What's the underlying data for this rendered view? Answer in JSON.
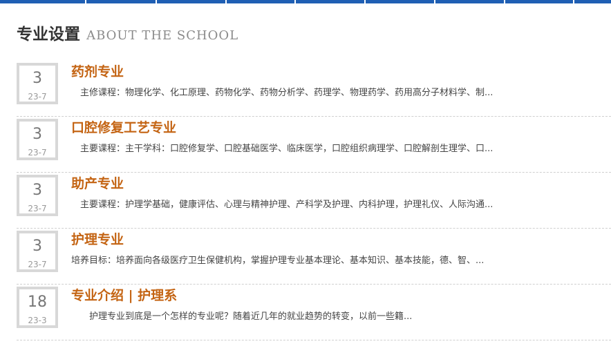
{
  "header": {
    "title_cn": "专业设置",
    "title_en": "ABOUT THE SCHOOL"
  },
  "colors": {
    "nav_bar": "#1f5fb4",
    "item_title": "#c46413",
    "date_border": "#d8d8d8"
  },
  "items": [
    {
      "day": "3",
      "ym": "23-7",
      "title": "药剂专业",
      "desc": "　主修课程：物理化学、化工原理、药物化学、药物分析学、药理学、物理药学、药用高分子材料学、制..."
    },
    {
      "day": "3",
      "ym": "23-7",
      "title": "口腔修复工艺专业",
      "desc": "　主要课程：主干学科：口腔修复学、口腔基础医学、临床医学，口腔组织病理学、口腔解剖生理学、口..."
    },
    {
      "day": "3",
      "ym": "23-7",
      "title": "助产专业",
      "desc": "　主要课程：护理学基础，健康评估、心理与精神护理、产科学及护理、内科护理，护理礼仪、人际沟通..."
    },
    {
      "day": "3",
      "ym": "23-7",
      "title": "护理专业",
      "desc": " 培养目标：培养面向各级医疗卫生保健机构，掌握护理专业基本理论、基本知识、基本技能，德、智、..."
    },
    {
      "day": "18",
      "ym": "23-3",
      "title": "专业介绍 | 护理系",
      "desc": "　　护理专业到底是一个怎样的专业呢？随着近几年的就业趋势的转变，以前一些籍..."
    }
  ]
}
